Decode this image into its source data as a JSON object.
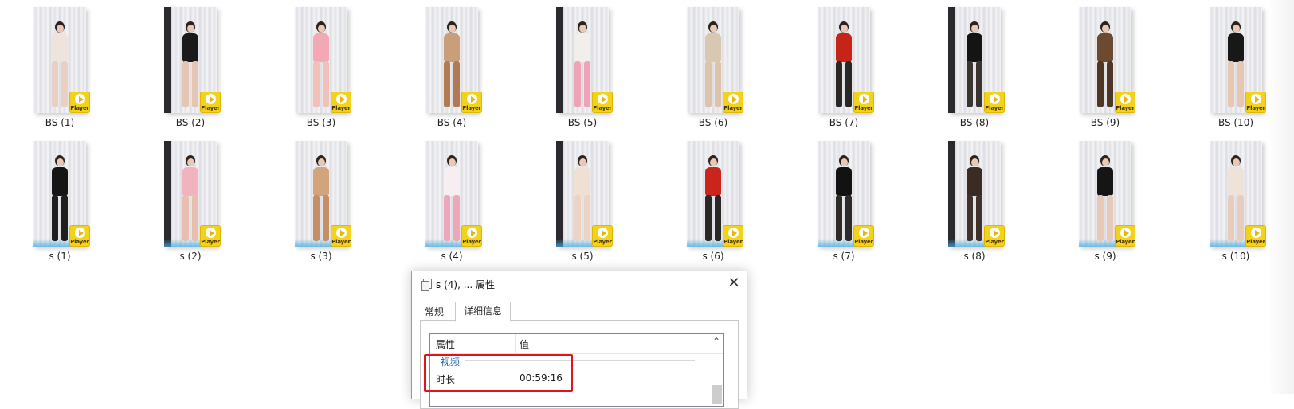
{
  "files_row1": [
    {
      "label": "BS (1)",
      "outfit": "#efe4dc",
      "legs": "#ead0c2",
      "badge_text": "Player"
    },
    {
      "label": "BS (2)",
      "outfit": "#1a1a1a",
      "legs": "#e6c5b2",
      "badge_text": "Player"
    },
    {
      "label": "BS (3)",
      "outfit": "#f3a9b5",
      "legs": "#efc1b9",
      "badge_text": "Player"
    },
    {
      "label": "BS (4)",
      "outfit": "#c99e7a",
      "legs": "#b07a52",
      "badge_text": "Player"
    },
    {
      "label": "BS (5)",
      "outfit": "#f1efea",
      "legs": "#eea3b6",
      "badge_text": "Player"
    },
    {
      "label": "BS (6)",
      "outfit": "#d8c7b1",
      "legs": "#dcc3a9",
      "badge_text": "Player"
    },
    {
      "label": "BS (7)",
      "outfit": "#c72418",
      "legs": "#2a2624",
      "badge_text": "Player"
    },
    {
      "label": "BS (8)",
      "outfit": "#141414",
      "legs": "#3a3430",
      "badge_text": "Player"
    },
    {
      "label": "BS (9)",
      "outfit": "#6b4a2f",
      "legs": "#4e3624",
      "badge_text": "Player"
    },
    {
      "label": "BS (10)",
      "outfit": "#181818",
      "legs": "#e7c6b2",
      "badge_text": "Player"
    }
  ],
  "files_row2": [
    {
      "label": "s (1)",
      "outfit": "#151515",
      "legs": "#1e1e1e",
      "badge_text": "Player"
    },
    {
      "label": "s (2)",
      "outfit": "#f2b3bf",
      "legs": "#e8bfae",
      "badge_text": "Player"
    },
    {
      "label": "s (3)",
      "outfit": "#d2a47b",
      "legs": "#c39066",
      "badge_text": "Player"
    },
    {
      "label": "s (4)",
      "outfit": "#f6eef0",
      "legs": "#eea6ba",
      "badge_text": "Player"
    },
    {
      "label": "s (5)",
      "outfit": "#f0e0d3",
      "legs": "#ecd3c3",
      "badge_text": "Player"
    },
    {
      "label": "s (6)",
      "outfit": "#c9251c",
      "legs": "#2b2725",
      "badge_text": "Player"
    },
    {
      "label": "s (7)",
      "outfit": "#121212",
      "legs": "#2e2a28",
      "badge_text": "Player"
    },
    {
      "label": "s (8)",
      "outfit": "#3a2c22",
      "legs": "#3f322a",
      "badge_text": "Player"
    },
    {
      "label": "s (9)",
      "outfit": "#151515",
      "legs": "#e8c9b6",
      "badge_text": "Player"
    },
    {
      "label": "s (10)",
      "outfit": "#efe2d8",
      "legs": "#e8ccbc",
      "badge_text": "Player"
    }
  ],
  "dialog": {
    "title": "s (4), ... 属性",
    "close_glyph": "✕",
    "tabs": [
      {
        "label": "常规"
      },
      {
        "label": "详细信息"
      }
    ],
    "columns": {
      "property": "属性",
      "value": "值"
    },
    "group_label": "视频",
    "rows": [
      {
        "key": "时长",
        "value": "00:59:16"
      }
    ],
    "collapse_glyph": "⌃"
  },
  "colors": {
    "highlight": "#e0141b",
    "badge": "#f2d21b",
    "group_text": "#1b5fa8"
  }
}
